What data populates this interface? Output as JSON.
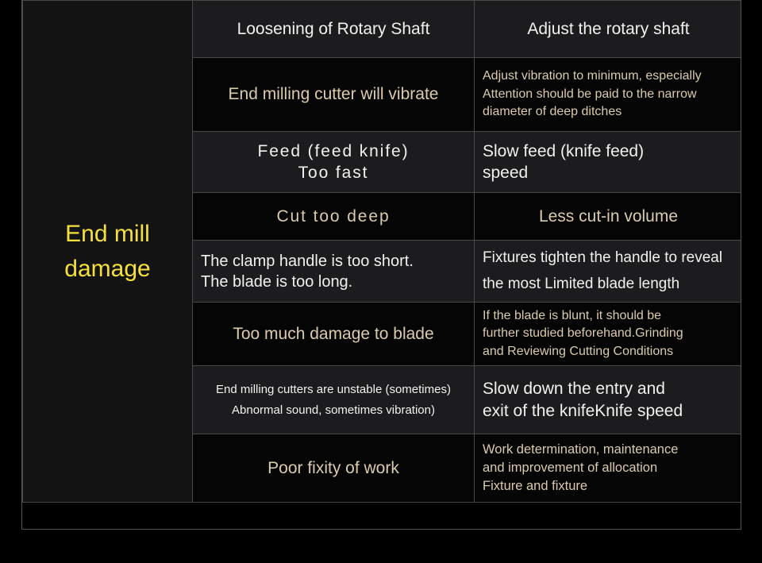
{
  "page": {
    "background_color": "#000000",
    "accent_yellow": "#f5e03c",
    "text_white": "#f2f1ef",
    "text_tan": "#dbcbab",
    "row_light_bg": "#1c1c1e",
    "row_dark_bg": "#050505",
    "border_color": "#4a4744"
  },
  "table": {
    "category_label": "End mill\ndamage",
    "rows": [
      {
        "cause": "Loosening of Rotary Shaft",
        "remedy": "Adjust the rotary shaft"
      },
      {
        "cause": "End milling cutter will vibrate",
        "remedy": "Adjust vibration to minimum, especially\nAttention should be paid to the narrow\ndiameter of deep ditches"
      },
      {
        "cause": "Feed (feed knife)\nToo fast",
        "remedy": "Slow feed (knife feed)\nspeed"
      },
      {
        "cause": "Cut too deep",
        "remedy": "Less cut-in volume"
      },
      {
        "cause": "The clamp handle is too short.\nThe blade is too long.",
        "remedy": "Fixtures tighten the handle to reveal\nthe most Limited blade length"
      },
      {
        "cause": "Too much damage to blade",
        "remedy": "If the blade is blunt, it should be\nfurther studied beforehand.Grinding\nand Reviewing Cutting Conditions"
      },
      {
        "cause": "End milling cutters are unstable (sometimes)\nAbnormal sound, sometimes vibration)",
        "remedy": "Slow down the entry and\nexit of the knifeKnife speed"
      },
      {
        "cause": "Poor fixity of work",
        "remedy": "Work determination, maintenance\nand improvement of allocation\nFixture and fixture"
      }
    ]
  }
}
